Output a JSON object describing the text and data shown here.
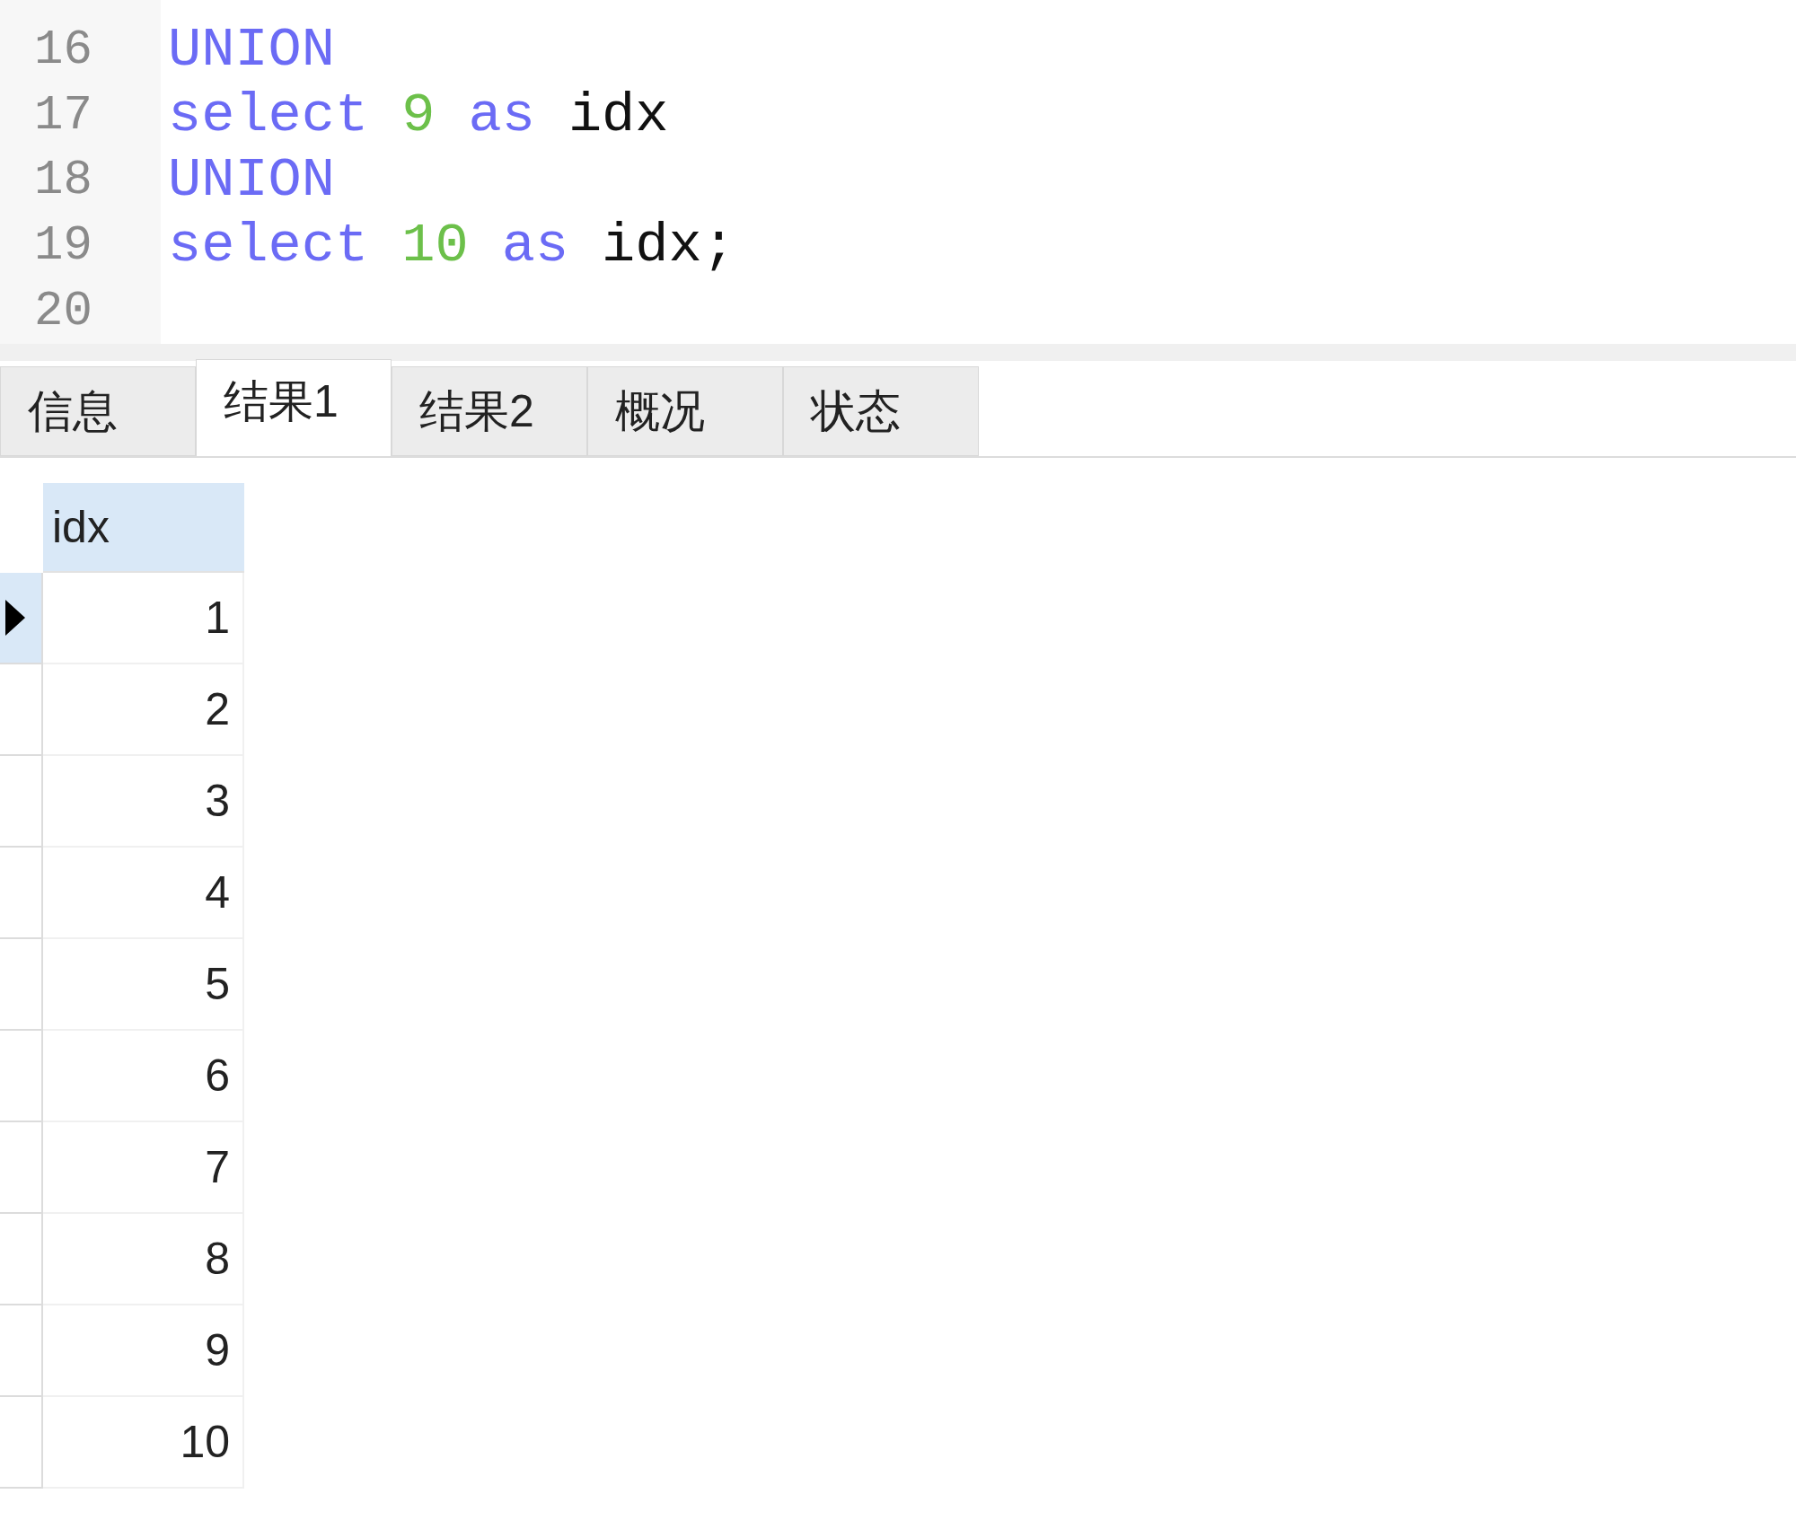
{
  "editor": {
    "lines": [
      {
        "number": "16",
        "tokens": [
          {
            "kind": "keyword",
            "text": "UNION"
          }
        ]
      },
      {
        "number": "17",
        "tokens": [
          {
            "kind": "keyword",
            "text": "select"
          },
          {
            "kind": "number",
            "text": "9"
          },
          {
            "kind": "keyword",
            "text": "as"
          },
          {
            "kind": "identifier",
            "text": "idx"
          }
        ]
      },
      {
        "number": "18",
        "tokens": [
          {
            "kind": "keyword",
            "text": "UNION"
          }
        ]
      },
      {
        "number": "19",
        "tokens": [
          {
            "kind": "keyword",
            "text": "select"
          },
          {
            "kind": "number",
            "text": "10"
          },
          {
            "kind": "keyword",
            "text": "as"
          },
          {
            "kind": "identifier",
            "text": "idx;"
          }
        ]
      },
      {
        "number": "20"
      }
    ]
  },
  "tabs": [
    {
      "label": "信息",
      "selected": false
    },
    {
      "label": "结果1",
      "selected": true
    },
    {
      "label": "结果2",
      "selected": false
    },
    {
      "label": "概况",
      "selected": false
    },
    {
      "label": "状态",
      "selected": false
    }
  ],
  "table": {
    "columns": [
      "idx"
    ],
    "rows": [
      {
        "cells": [
          "1"
        ],
        "selected": true
      },
      {
        "cells": [
          "2"
        ],
        "selected": false
      },
      {
        "cells": [
          "3"
        ],
        "selected": false
      },
      {
        "cells": [
          "4"
        ],
        "selected": false
      },
      {
        "cells": [
          "5"
        ],
        "selected": false
      },
      {
        "cells": [
          "6"
        ],
        "selected": false
      },
      {
        "cells": [
          "7"
        ],
        "selected": false
      },
      {
        "cells": [
          "8"
        ],
        "selected": false
      },
      {
        "cells": [
          "9"
        ],
        "selected": false
      },
      {
        "cells": [
          "10"
        ],
        "selected": false
      }
    ]
  }
}
